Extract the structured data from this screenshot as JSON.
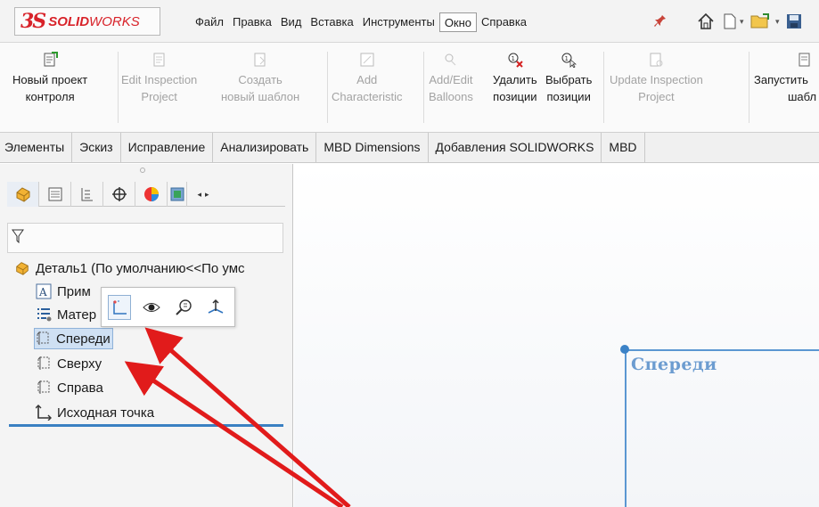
{
  "app": {
    "logo_mark": "3S",
    "brand_solid": "SOLID",
    "brand_works": "WORKS"
  },
  "menu": {
    "items": [
      "Файл",
      "Правка",
      "Вид",
      "Вставка",
      "Инструменты",
      "Окно",
      "Справка"
    ],
    "active": "Окно"
  },
  "quick_access": {
    "icons": [
      "pin-icon",
      "home-icon",
      "new-document-icon",
      "open-folder-icon",
      "save-icon"
    ]
  },
  "ribbon": {
    "buttons": [
      {
        "line1": "Новый проект",
        "line2": "контроля",
        "enabled": true,
        "icon": "new-inspection-project-icon"
      },
      {
        "line1": "Edit Inspection",
        "line2": "Project",
        "enabled": false,
        "icon": "edit-inspection-icon"
      },
      {
        "line1": "Создать",
        "line2": "новый шаблон",
        "enabled": false,
        "icon": "new-template-icon"
      },
      {
        "line1": "Add",
        "line2": "Characteristic",
        "enabled": false,
        "icon": "add-characteristic-icon"
      },
      {
        "line1": "Add/Edit",
        "line2": "Balloons",
        "enabled": false,
        "icon": "balloons-icon"
      },
      {
        "line1": "Удалить",
        "line2": "позиции",
        "enabled": true,
        "icon": "delete-balloons-icon"
      },
      {
        "line1": "Выбрать",
        "line2": "позиции",
        "enabled": true,
        "icon": "select-balloons-icon"
      },
      {
        "line1": "Update Inspection",
        "line2": "Project",
        "enabled": false,
        "icon": "update-inspection-icon"
      },
      {
        "line1": "Запустить",
        "line2": "шабл",
        "enabled": true,
        "icon": "launch-template-icon"
      }
    ]
  },
  "command_tabs": [
    "Элементы",
    "Эскиз",
    "Исправление",
    "Анализировать",
    "MBD Dimensions",
    "Добавления SOLIDWORKS",
    "MBD"
  ],
  "feature_tree": {
    "root": "Деталь1  (По умолчанию<<По умс",
    "items": [
      {
        "label": "Прим",
        "icon": "annotations-icon"
      },
      {
        "label": "Матер",
        "icon": "material-icon"
      },
      {
        "label": "Спереди",
        "icon": "plane-icon",
        "selected": true
      },
      {
        "label": "Сверху",
        "icon": "plane-icon"
      },
      {
        "label": "Справа",
        "icon": "plane-icon"
      },
      {
        "label": "Исходная точка",
        "icon": "origin-icon"
      }
    ]
  },
  "context_toolbar": [
    "sketch-icon",
    "show-hide-icon",
    "zoom-to-selection-icon",
    "normal-to-icon"
  ],
  "graphics": {
    "plane_label": "Спереди"
  },
  "colors": {
    "brand_red": "#d8232a",
    "selection": "#cfe0f3",
    "plane_blue": "#5b97d2",
    "arrow_red": "#e11b1b"
  }
}
